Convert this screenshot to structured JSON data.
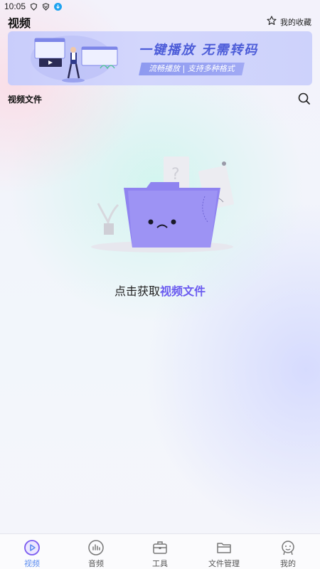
{
  "status_bar": {
    "time": "10:05"
  },
  "header": {
    "title": "视频",
    "favorites_label": "我的收藏"
  },
  "banner": {
    "title": "一键播放 无需转码",
    "subtitle": "流畅播放 | 支持多种格式"
  },
  "section": {
    "title": "视频文件"
  },
  "empty_state": {
    "prefix": "点击获取",
    "link": "视频文件"
  },
  "bottom_nav": {
    "items": [
      {
        "label": "视频",
        "icon": "video-play-icon",
        "active": true
      },
      {
        "label": "音频",
        "icon": "audio-bars-icon",
        "active": false
      },
      {
        "label": "工具",
        "icon": "toolbox-icon",
        "active": false
      },
      {
        "label": "文件管理",
        "icon": "folder-icon",
        "active": false
      },
      {
        "label": "我的",
        "icon": "profile-face-icon",
        "active": false
      }
    ]
  },
  "colors": {
    "accent": "#5b8cf0",
    "link": "#6b5cf0",
    "banner_title": "#4c5cd8"
  }
}
